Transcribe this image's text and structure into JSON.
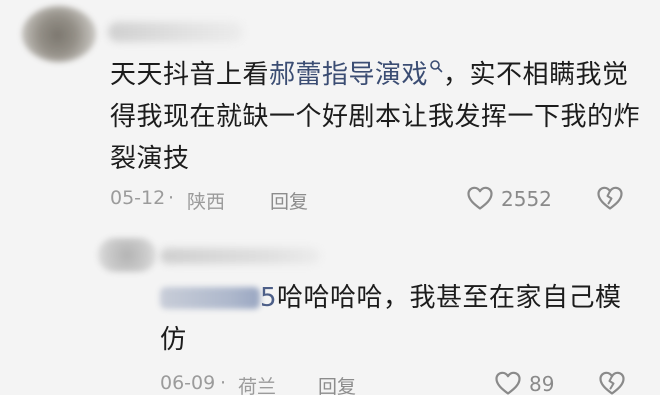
{
  "comment": {
    "text_before": "天天抖音上看",
    "topic": "郝蕾指导演戏",
    "text_after": "，实不相瞒我觉得我现在就缺一个好剧本让我发挥一下我的炸裂演技",
    "date": "05-12",
    "separator": "·",
    "location": "陕西",
    "reply_label": "回复",
    "like_count": "2552",
    "icons": [
      "search-icon",
      "heart-icon",
      "broken-heart-icon"
    ]
  },
  "reply": {
    "mention": "5",
    "text": "哈哈哈哈，我甚至在家自己模仿",
    "date": "06-09",
    "separator": "·",
    "location": "荷兰",
    "reply_label": "回复",
    "like_count": "89",
    "icons": [
      "heart-icon",
      "broken-heart-icon"
    ]
  },
  "colors": {
    "background": "#f4f4f4",
    "text": "#1c1c1c",
    "topic_link": "#3b4d73",
    "meta": "#9b9b9b"
  }
}
